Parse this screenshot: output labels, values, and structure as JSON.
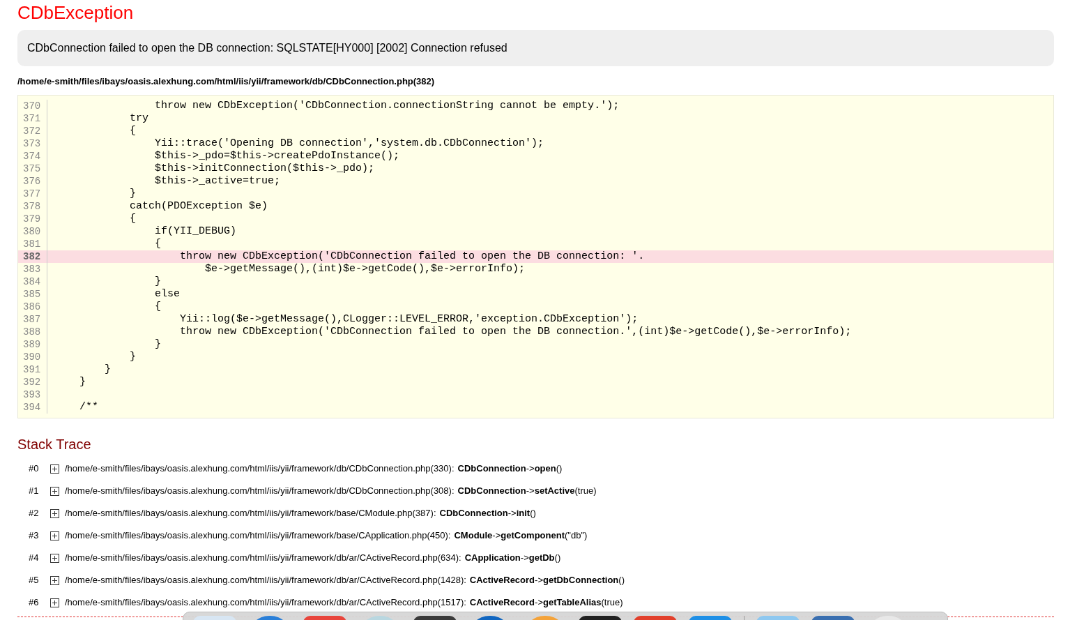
{
  "title": "CDbException",
  "message": "CDbConnection failed to open the DB connection: SQLSTATE[HY000] [2002] Connection refused",
  "source_file": "/home/e-smith/files/ibays/oasis.alexhung.com/html/iis/yii/framework/db/CDbConnection.php(382)",
  "code_lines": [
    {
      "number": "370",
      "code": "                throw new CDbException('CDbConnection.connectionString cannot be empty.');",
      "selected": false
    },
    {
      "number": "371",
      "code": "            try",
      "selected": false
    },
    {
      "number": "372",
      "code": "            {",
      "selected": false
    },
    {
      "number": "373",
      "code": "                Yii::trace('Opening DB connection','system.db.CDbConnection');",
      "selected": false
    },
    {
      "number": "374",
      "code": "                $this->_pdo=$this->createPdoInstance();",
      "selected": false
    },
    {
      "number": "375",
      "code": "                $this->initConnection($this->_pdo);",
      "selected": false
    },
    {
      "number": "376",
      "code": "                $this->_active=true;",
      "selected": false
    },
    {
      "number": "377",
      "code": "            }",
      "selected": false
    },
    {
      "number": "378",
      "code": "            catch(PDOException $e)",
      "selected": false
    },
    {
      "number": "379",
      "code": "            {",
      "selected": false
    },
    {
      "number": "380",
      "code": "                if(YII_DEBUG)",
      "selected": false
    },
    {
      "number": "381",
      "code": "                {",
      "selected": false
    },
    {
      "number": "382",
      "code": "                    throw new CDbException('CDbConnection failed to open the DB connection: '.",
      "selected": true
    },
    {
      "number": "383",
      "code": "                        $e->getMessage(),(int)$e->getCode(),$e->errorInfo);",
      "selected": false
    },
    {
      "number": "384",
      "code": "                }",
      "selected": false
    },
    {
      "number": "385",
      "code": "                else",
      "selected": false
    },
    {
      "number": "386",
      "code": "                {",
      "selected": false
    },
    {
      "number": "387",
      "code": "                    Yii::log($e->getMessage(),CLogger::LEVEL_ERROR,'exception.CDbException');",
      "selected": false
    },
    {
      "number": "388",
      "code": "                    throw new CDbException('CDbConnection failed to open the DB connection.',(int)$e->getCode(),$e->errorInfo);",
      "selected": false
    },
    {
      "number": "389",
      "code": "                }",
      "selected": false
    },
    {
      "number": "390",
      "code": "            }",
      "selected": false
    },
    {
      "number": "391",
      "code": "        }",
      "selected": false
    },
    {
      "number": "392",
      "code": "    }",
      "selected": false
    },
    {
      "number": "393",
      "selected": false
    },
    {
      "number": "394",
      "code": "    /**",
      "selected": false
    }
  ],
  "stack_trace": {
    "title": "Stack Trace",
    "items": [
      {
        "index": "#0",
        "expanded": false,
        "location": "/home/e-smith/files/ibays/oasis.alexhung.com/html/iis/yii/framework/db/CDbConnection.php(330):",
        "call": "**CDbConnection**->**open**()"
      },
      {
        "index": "#1",
        "expanded": false,
        "location": "/home/e-smith/files/ibays/oasis.alexhung.com/html/iis/yii/framework/db/CDbConnection.php(308):",
        "call": "**CDbConnection**->**setActive**(true)"
      },
      {
        "index": "#2",
        "expanded": false,
        "location": "/home/e-smith/files/ibays/oasis.alexhung.com/html/iis/yii/framework/base/CModule.php(387):",
        "call": "**CDbConnection**->**init**()"
      },
      {
        "index": "#3",
        "expanded": false,
        "location": "/home/e-smith/files/ibays/oasis.alexhung.com/html/iis/yii/framework/base/CApplication.php(450):",
        "call": "**CModule**->**getComponent**(\"db\")"
      },
      {
        "index": "#4",
        "expanded": false,
        "location": "/home/e-smith/files/ibays/oasis.alexhung.com/html/iis/yii/framework/db/ar/CActiveRecord.php(634):",
        "call": "**CApplication**->**getDb**()"
      },
      {
        "index": "#5",
        "expanded": false,
        "location": "/home/e-smith/files/ibays/oasis.alexhung.com/html/iis/yii/framework/db/ar/CActiveRecord.php(1428):",
        "call": "**CActiveRecord**->**getDbConnection**()"
      },
      {
        "index": "#6",
        "expanded": false,
        "location": "/home/e-smith/files/ibays/oasis.alexhung.com/html/iis/yii/framework/db/ar/CActiveRecord.php(1517):",
        "call": "**CActiveRecord**->**getTableAlias**(true)"
      }
    ]
  }
}
